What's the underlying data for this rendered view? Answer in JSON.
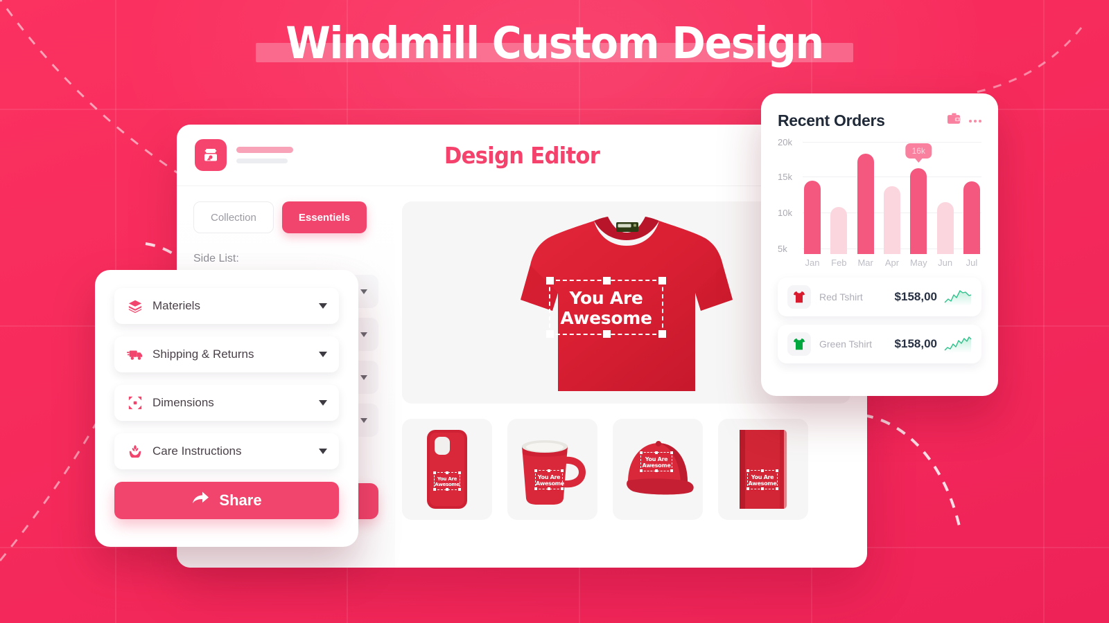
{
  "page": {
    "title": "Windmill Custom Design",
    "background_color": "#F72D5E",
    "accent_color": "#F2456D"
  },
  "editor": {
    "title": "Design Editor",
    "logo_icon": "image-frame-icon",
    "tabs": [
      {
        "label": "Collection",
        "active": false
      },
      {
        "label": "Essentiels",
        "active": true
      }
    ],
    "side_list_label": "Side List:",
    "align_icon": "text-align-icon",
    "canvas": {
      "product": "red-tshirt",
      "design_text_line1": "You Are",
      "design_text_line2": "Awesome"
    },
    "thumbnails": [
      {
        "name": "phone-case",
        "design_line1": "You Are",
        "design_line2": "Awesome"
      },
      {
        "name": "coffee-mug",
        "design_line1": "You Are",
        "design_line2": "Awesome"
      },
      {
        "name": "baseball-cap",
        "design_line1": "You Are",
        "design_line2": "Awesome"
      },
      {
        "name": "notebook",
        "design_line1": "You Are",
        "design_line2": "Awesome"
      }
    ]
  },
  "accordion": {
    "items": [
      {
        "label": "Materiels",
        "icon": "layers-icon"
      },
      {
        "label": "Shipping & Returns",
        "icon": "truck-icon"
      },
      {
        "label": "Dimensions",
        "icon": "expand-arrows-icon"
      },
      {
        "label": "Care Instructions",
        "icon": "care-hands-icon"
      }
    ],
    "share_label": "Share",
    "share_icon": "share-arrow-icon"
  },
  "orders": {
    "title": "Recent Orders",
    "wallet_icon": "wallet-icon",
    "menu_icon": "more-dots-icon",
    "items": [
      {
        "name": "Red Tshirt",
        "price": "$158,00",
        "icon": "red-tshirt-icon",
        "trend": "up"
      },
      {
        "name": "Green Tshirt",
        "price": "$158,00",
        "icon": "green-tshirt-icon",
        "trend": "up"
      }
    ]
  },
  "chart_data": {
    "type": "bar",
    "title": "Recent Orders",
    "xlabel": "",
    "ylabel": "",
    "categories": [
      "Jan",
      "Feb",
      "Mar",
      "Apr",
      "May",
      "Jun",
      "Jul"
    ],
    "values": [
      15.4,
      11.7,
      19.2,
      14.6,
      17.2,
      12.4,
      15.3
    ],
    "unit": "k",
    "ytick_labels": [
      "20k",
      "15k",
      "10k",
      "5k"
    ],
    "ytick_values": [
      20,
      15,
      10,
      5
    ],
    "ylim": [
      5,
      21
    ],
    "grid": true,
    "legend": "none",
    "highlight_index": 4,
    "highlight_label": "16k",
    "bar_colors": [
      "#F4587E",
      "#FBD6DE",
      "#F4587E",
      "#FBD6DE",
      "#F4587E",
      "#FBD6DE",
      "#F4587E"
    ]
  }
}
